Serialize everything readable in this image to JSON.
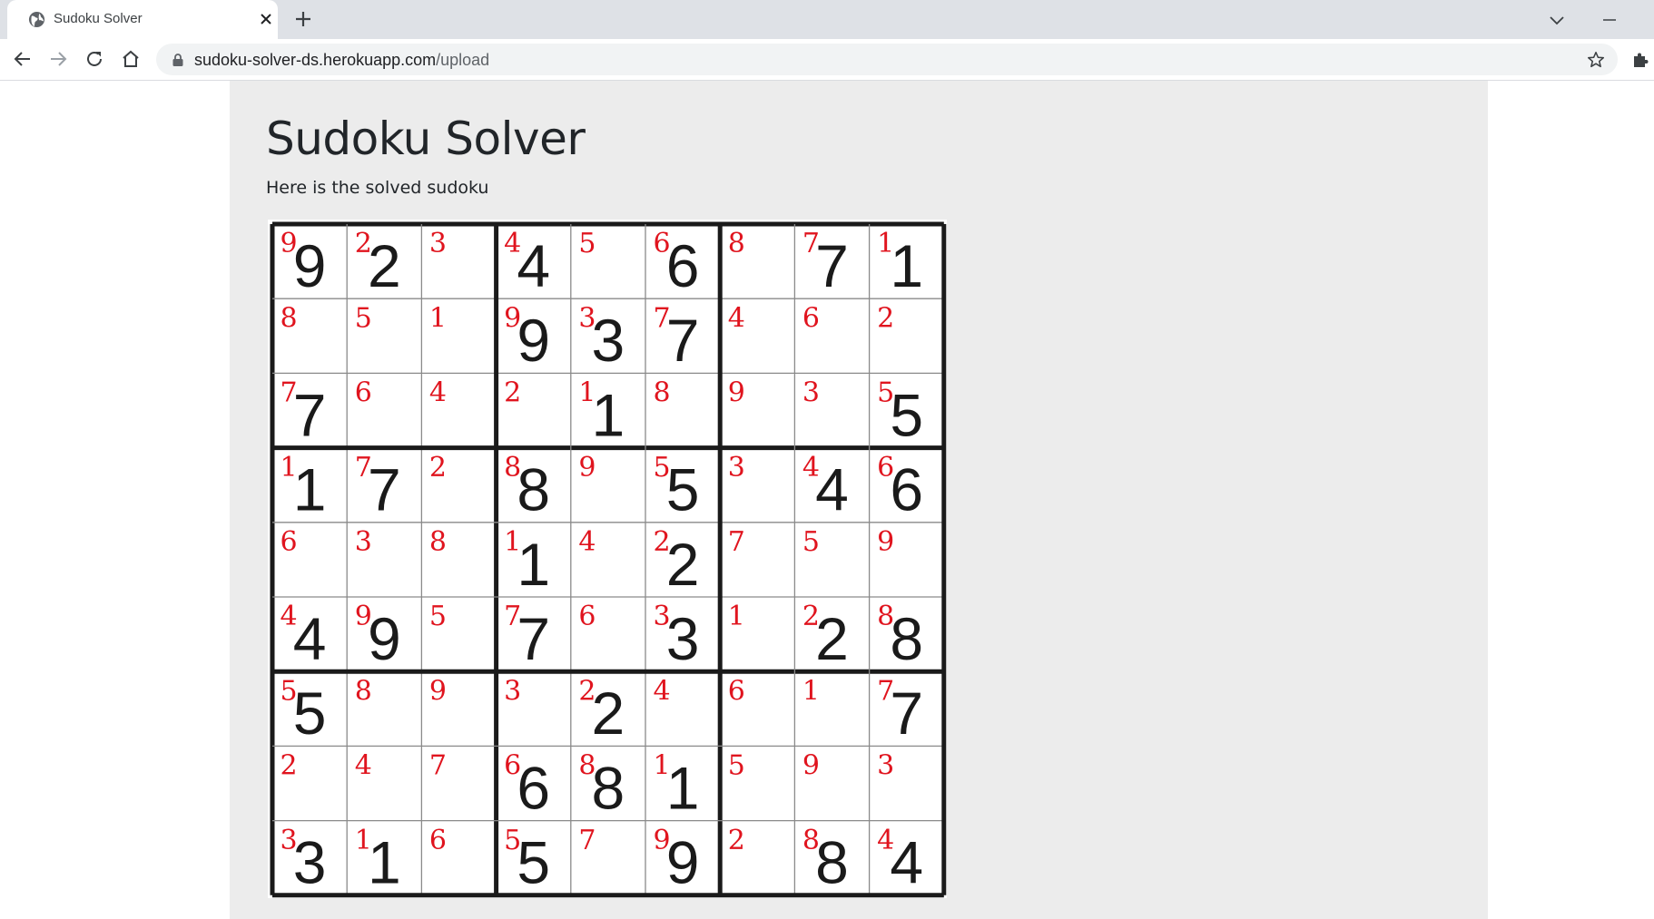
{
  "browser": {
    "tab_title": "Sudoku Solver",
    "url_host": "sudoku-solver-ds.herokuapp.com",
    "url_path": "/upload"
  },
  "page": {
    "title": "Sudoku Solver",
    "subtitle": "Here is the solved sudoku"
  },
  "sudoku": {
    "grid_color": "#1a1a1a",
    "given_color": "#1a1a1a",
    "solved_color": "#e0141e",
    "solution": [
      [
        9,
        2,
        3,
        4,
        5,
        6,
        8,
        7,
        1
      ],
      [
        8,
        5,
        1,
        9,
        3,
        7,
        4,
        6,
        2
      ],
      [
        7,
        6,
        4,
        2,
        1,
        8,
        9,
        3,
        5
      ],
      [
        1,
        7,
        2,
        8,
        9,
        5,
        3,
        4,
        6
      ],
      [
        6,
        3,
        8,
        1,
        4,
        2,
        7,
        5,
        9
      ],
      [
        4,
        9,
        5,
        7,
        6,
        3,
        1,
        2,
        8
      ],
      [
        5,
        8,
        9,
        3,
        2,
        4,
        6,
        1,
        7
      ],
      [
        2,
        4,
        7,
        6,
        8,
        1,
        5,
        9,
        3
      ],
      [
        3,
        1,
        6,
        5,
        7,
        9,
        2,
        8,
        4
      ]
    ],
    "givens": [
      [
        9,
        2,
        0,
        4,
        0,
        6,
        0,
        7,
        1
      ],
      [
        0,
        0,
        0,
        9,
        3,
        7,
        0,
        0,
        0
      ],
      [
        7,
        0,
        0,
        0,
        1,
        0,
        0,
        0,
        5
      ],
      [
        1,
        7,
        0,
        8,
        0,
        5,
        0,
        4,
        6
      ],
      [
        0,
        0,
        0,
        1,
        0,
        2,
        0,
        0,
        0
      ],
      [
        4,
        9,
        0,
        7,
        0,
        3,
        0,
        2,
        8
      ],
      [
        5,
        0,
        0,
        0,
        2,
        0,
        0,
        0,
        7
      ],
      [
        0,
        0,
        0,
        6,
        8,
        1,
        0,
        0,
        0
      ],
      [
        3,
        1,
        0,
        5,
        0,
        9,
        0,
        8,
        4
      ]
    ]
  }
}
